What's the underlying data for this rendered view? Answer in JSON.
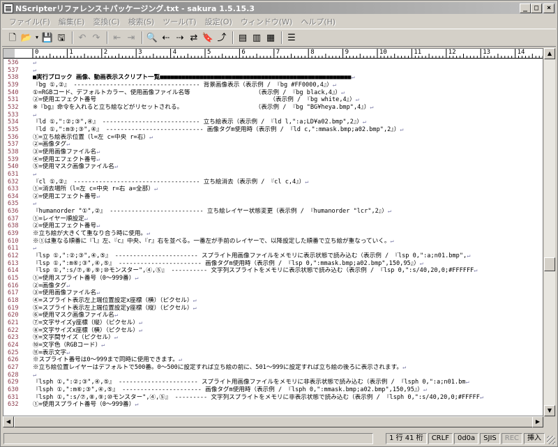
{
  "window": {
    "title": "NScripterリファレンス＋パッケージング.txt - sakura 1.5.15.3",
    "controls": {
      "minimize": "_",
      "maximize": "□",
      "close": "×"
    }
  },
  "menu": [
    "ファイル(F)",
    "編集(E)",
    "変換(C)",
    "検索(S)",
    "ツール(T)",
    "設定(O)",
    "ウィンドウ(W)",
    "ヘルプ(H)"
  ],
  "toolbar": {
    "icons": [
      "new-file-icon",
      "open-file-icon",
      "open-dropdown-icon",
      "save-icon",
      "save-as-icon",
      "undo-icon",
      "redo-icon",
      "back-icon",
      "forward-icon",
      "search-icon",
      "search-prev-icon",
      "search-next-icon",
      "replace-icon",
      "bookmark-icon",
      "tag-jump-icon",
      "grep-icon",
      "compare-icon",
      "settings-icon"
    ]
  },
  "ruler": {
    "labels": [
      "0",
      "1",
      "2",
      "3",
      "4",
      "5",
      "6",
      "7",
      "8",
      "9",
      "10",
      "11",
      "12",
      "13",
      "14"
    ]
  },
  "editor": {
    "lines": [
      {
        "n": "536",
        "t": ""
      },
      {
        "n": "537",
        "t": ""
      },
      {
        "n": "538",
        "t": "■実行ブロック 画像、動画表示スクリプト一覧■■■■■■■■■■■■■■■■■■■■■■■■■■■■■■■■■■■■■■■■■■■■■■■■■■■■■",
        "heading": true
      },
      {
        "n": "539",
        "t": "『bg ①,②』 ----------------------------------- 背景画像表示（表示例 / 『bg #FF0000,4』）"
      },
      {
        "n": "540",
        "t": "①=RGBコード、デフォルトカラー、使用画像ファイル名等                  （表示例 / 『bg black,4』）"
      },
      {
        "n": "531",
        "t": "②=使用エフェクト番号                                                （表示例 / 『bg white,4』）"
      },
      {
        "n": "532",
        "t": "※『bg』命令を入れると立ち絵などがリセットされる。                    （表示例 / 『bg \"BG¥heya.bmp\",4』）"
      },
      {
        "n": "533",
        "t": ""
      },
      {
        "n": "534",
        "t": "『ld ①,\":②;③\",④』 --------------------------- 立ち絵表示（表示例 / 『ld l,\":a;LD¥a02.bmp\",2』）"
      },
      {
        "n": "535",
        "t": "『ld ①,\":m③;③\",④』 --------------------------- 画像タグm使用時（表示例 / 『ld c,\":mmask.bmp;a02.bmp\",2』）"
      },
      {
        "n": "536",
        "t": "①=立ち絵表示位置（l=左 c=中央 r=右）"
      },
      {
        "n": "537",
        "t": "②=画像タグ"
      },
      {
        "n": "538",
        "t": "③=使用画像ファイル名"
      },
      {
        "n": "539",
        "t": "④=使用エフェクト番号"
      },
      {
        "n": "540",
        "t": "⑤=使用マスク画像ファイル名"
      },
      {
        "n": "631",
        "t": ""
      },
      {
        "n": "632",
        "t": "『cl ①,②』 ----------------------------------- 立ち絵消去（表示例 / 『cl c,4』）"
      },
      {
        "n": "633",
        "t": "①=消去場所（l=左 c=中央 r=右 a=全部）"
      },
      {
        "n": "634",
        "t": "②=使用エフェクト番号"
      },
      {
        "n": "635",
        "t": ""
      },
      {
        "n": "636",
        "t": "『humanorder \"①\",②』 -------------------------- 立ち絵レイヤー状態変更（表示例 / 『humanorder \"lcr\",2』）"
      },
      {
        "n": "637",
        "t": "①=レイヤー順設定"
      },
      {
        "n": "638",
        "t": "②=使用エフェクト番号"
      },
      {
        "n": "639",
        "t": "※立ち絵が大きくて重なり合う時に使用。"
      },
      {
        "n": "610",
        "t": "※①は重なる順番に『l』左、『c』中央、『r』右を並べる。一番左が手前のレイヤーで、以降設定した順番で立ち絵が重なっていく。"
      },
      {
        "n": "611",
        "t": ""
      },
      {
        "n": "612",
        "t": "『lsp ①,\":②;③\",④,⑤』 ----------------------- スプライト用画像ファイルをメモリに表示状態で読み込む（表示例 / 『lsp 0,\":a;n01.bmp\","
      },
      {
        "n": "613",
        "t": "『lsp ①,\":m⑥;③\",④,⑤』 ----------------------- 画像タグm使用時（表示例 / 『lsp 0,\":mmask.bmp;a02.bmp\",150,95』）"
      },
      {
        "n": "614",
        "t": "『lsp ①,\":s/⑦,⑧,⑨;⑩モンスター\",④,⑤』 ---------- 文字列スプライトをメモリに表示状態で読み込む（表示例 / 『lsp 0,\":s/40,20,0;#FFFFFF"
      },
      {
        "n": "615",
        "t": "①=使用スプライト番号（0～999番）"
      },
      {
        "n": "616",
        "t": "②=画像タグ"
      },
      {
        "n": "617",
        "t": "③=使用画像ファイル名"
      },
      {
        "n": "618",
        "t": "④=スプライト表示左上端位置設定x座標（横）（ピクセル）"
      },
      {
        "n": "619",
        "t": "⑤=スプライト表示左上端位置設定y座標（縦）（ピクセル）"
      },
      {
        "n": "620",
        "t": "⑥=使用マスク画像ファイル名"
      },
      {
        "n": "621",
        "t": "⑦=文字サイズy座標（縦）（ピクセル）"
      },
      {
        "n": "622",
        "t": "⑧=文字サイズx座標（横）（ピクセル）"
      },
      {
        "n": "623",
        "t": "⑨=文字間サイズ（ピクセル）"
      },
      {
        "n": "624",
        "t": "⑩=文字色（RGBコード）"
      },
      {
        "n": "625",
        "t": "⑪=表示文字"
      },
      {
        "n": "626",
        "t": "※スプライト番号は0～999まで同時に使用できます。"
      },
      {
        "n": "627",
        "t": "※立ち絵位置レイヤーはデフォルトで500番。0～500に設定すれば立ち絵の前に、501～999に設定すれば立ち絵の後ろに表示されます。"
      },
      {
        "n": "628",
        "t": ""
      },
      {
        "n": "629",
        "t": "『lsph ①,\":②;③\",④,⑤』 ---------------------- スプライト用画像ファイルをメモリに非表示状態で読み込む（表示例 / 『lsph 0,\":a;n01.bm"
      },
      {
        "n": "630",
        "t": "『lsph ①,\":m⑥;③\",④,⑤』 ---------------------- 画像タグm使用時（表示例 / 『lsph 0,\":mmask.bmp;a02.bmp\",150,95』）"
      },
      {
        "n": "631",
        "t": "『lsph ①,\":s/⑦,⑧,⑨;⑩モンスター\",④,⑤』 --------- 文字列スプライトをメモリに非表示状態で読み込む（表示例 / 『lsph 0,\":s/40,20,0;#FFFFF"
      },
      {
        "n": "632",
        "t": "①=使用スプライト番号（0～999番）"
      }
    ]
  },
  "status": {
    "position": "1 行  41 桁",
    "eol": "CRLF",
    "code": "0d0a",
    "encoding": "SJIS",
    "rec": "REC",
    "mode": "挿入"
  }
}
